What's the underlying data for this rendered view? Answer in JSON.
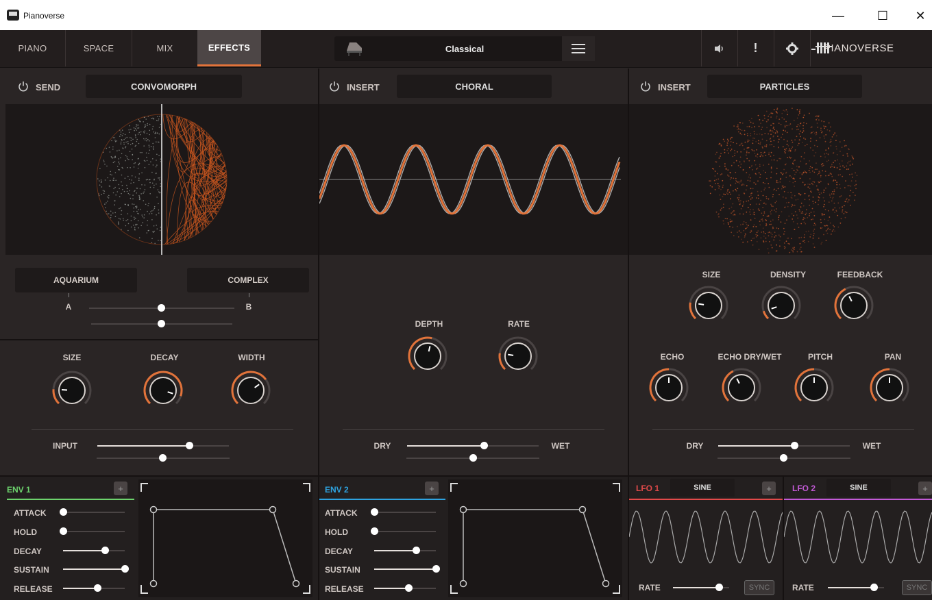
{
  "window": {
    "title": "Pianoverse",
    "minimize": "—",
    "maximize": "☐",
    "close": "✕"
  },
  "tabs": [
    {
      "label": "PIANO",
      "active": false
    },
    {
      "label": "SPACE",
      "active": false
    },
    {
      "label": "MIX",
      "active": false
    },
    {
      "label": "EFFECTS",
      "active": true
    }
  ],
  "preset": {
    "name": "Classical"
  },
  "brand": "PIANOVERSE",
  "colors": {
    "accent": "#e2733a",
    "env1": "#6dd36d",
    "env2": "#2ea3e0",
    "lfo1": "#e24a4a",
    "lfo2": "#c25ad6"
  },
  "send": {
    "mode": "SEND",
    "effect": "CONVOMORPH",
    "ir_a": "AQUARIUM",
    "ir_b": "COMPLEX",
    "a_label": "A",
    "b_label": "B",
    "morph": 0.5,
    "knobs": [
      {
        "label": "SIZE",
        "value": 0.18
      },
      {
        "label": "DECAY",
        "value": 0.9
      },
      {
        "label": "WIDTH",
        "value": 0.7
      }
    ],
    "input_label": "INPUT",
    "input": 0.7
  },
  "insert1": {
    "mode": "INSERT",
    "effect": "CHORAL",
    "knobs": [
      {
        "label": "DEPTH",
        "value": 0.55
      },
      {
        "label": "RATE",
        "value": 0.2
      }
    ],
    "dry_label": "DRY",
    "wet_label": "WET",
    "mix": 0.58
  },
  "insert2": {
    "mode": "INSERT",
    "effect": "PARTICLES",
    "knobs_row1": [
      {
        "label": "SIZE",
        "value": 0.2
      },
      {
        "label": "DENSITY",
        "value": 0.1
      },
      {
        "label": "FEEDBACK",
        "value": 0.4
      }
    ],
    "knobs_row2": [
      {
        "label": "ECHO",
        "value": 0.5
      },
      {
        "label": "ECHO DRY/WET",
        "value": 0.4
      },
      {
        "label": "PITCH",
        "value": 0.5
      },
      {
        "label": "PAN",
        "value": 0.5
      }
    ],
    "dry_label": "DRY",
    "wet_label": "WET",
    "mix": 0.58
  },
  "env1": {
    "title": "ENV 1",
    "add": "+",
    "params": [
      {
        "label": "ATTACK",
        "value": 0.0
      },
      {
        "label": "HOLD",
        "value": 0.0
      },
      {
        "label": "DECAY",
        "value": 0.68
      },
      {
        "label": "SUSTAIN",
        "value": 1.0
      },
      {
        "label": "RELEASE",
        "value": 0.55
      }
    ]
  },
  "env2": {
    "title": "ENV 2",
    "add": "+",
    "params": [
      {
        "label": "ATTACK",
        "value": 0.0
      },
      {
        "label": "HOLD",
        "value": 0.0
      },
      {
        "label": "DECAY",
        "value": 0.68
      },
      {
        "label": "SUSTAIN",
        "value": 1.0
      },
      {
        "label": "RELEASE",
        "value": 0.55
      }
    ]
  },
  "lfo1": {
    "title": "LFO 1",
    "shape": "SINE",
    "add": "+",
    "rate_label": "RATE",
    "rate": 0.75,
    "sync": "SYNC"
  },
  "lfo2": {
    "title": "LFO 2",
    "shape": "SINE",
    "add": "+",
    "rate_label": "RATE",
    "rate": 0.75,
    "sync": "SYNC"
  }
}
